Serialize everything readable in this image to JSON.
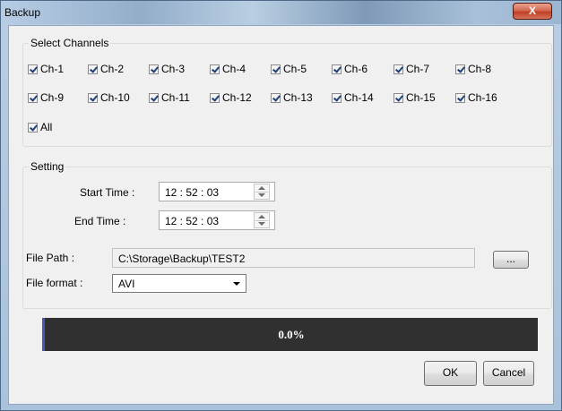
{
  "window": {
    "title": "Backup",
    "close_label": "X"
  },
  "channels": {
    "legend": "Select Channels",
    "items": [
      "Ch-1",
      "Ch-2",
      "Ch-3",
      "Ch-4",
      "Ch-5",
      "Ch-6",
      "Ch-7",
      "Ch-8",
      "Ch-9",
      "Ch-10",
      "Ch-11",
      "Ch-12",
      "Ch-13",
      "Ch-14",
      "Ch-15",
      "Ch-16"
    ],
    "all_label": "All"
  },
  "setting": {
    "legend": "Setting",
    "start_label": "Start Time :",
    "start_value": "12 : 52 : 03",
    "end_label": "End Time  :",
    "end_value": "12 : 52 : 03",
    "path_label": "File Path :",
    "path_value": "C:\\Storage\\Backup\\TEST2",
    "browse_label": "...",
    "format_label": "File format :",
    "format_value": "AVI"
  },
  "progress": {
    "value": 0.0,
    "text": "0.0%"
  },
  "buttons": {
    "ok": "OK",
    "cancel": "Cancel"
  },
  "colors": {
    "progress_bg": "#303030",
    "progress_accent": "#4b58b8",
    "close_red": "#c04025"
  }
}
